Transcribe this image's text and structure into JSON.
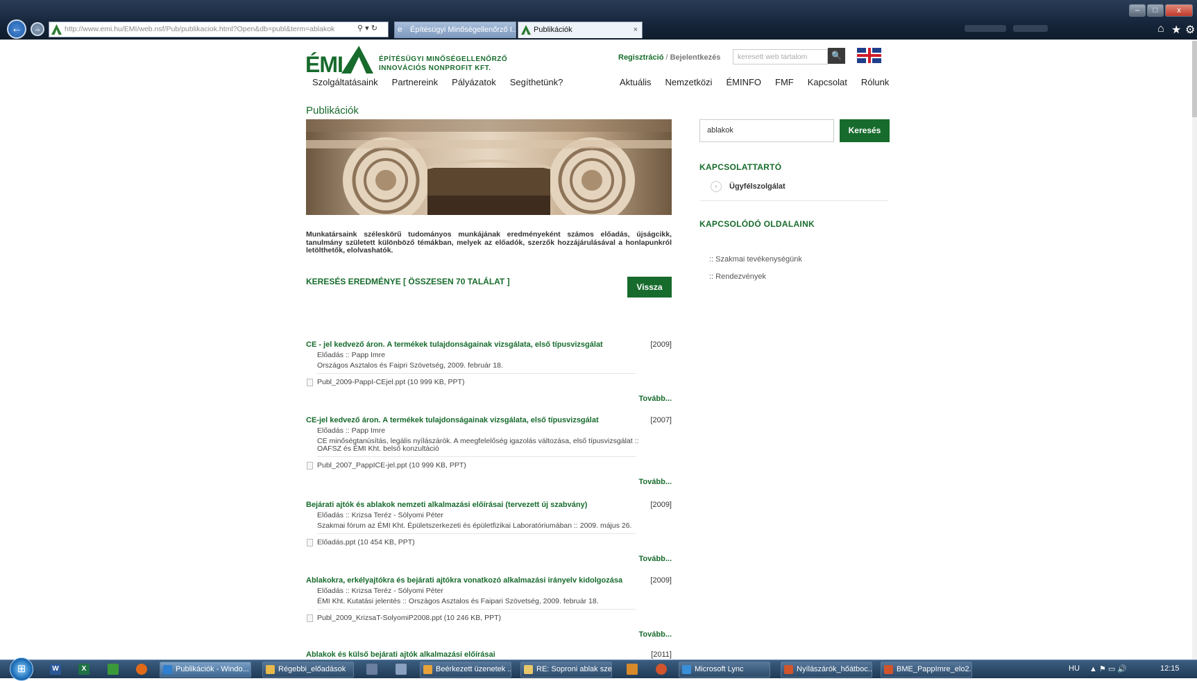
{
  "browser": {
    "address": "http://www.emi.hu/EMI/web.nsf/Pub/publikaciok.html?Open&db=publ&term=ablakok",
    "tabs": [
      {
        "label": "Építésügyi Minőségellenőrző I..."
      },
      {
        "label": "Publikációk",
        "close": "×"
      }
    ],
    "window_controls": [
      "–",
      "□",
      "x"
    ],
    "toolbar_icons": [
      "home-icon",
      "star-icon",
      "gear-icon"
    ]
  },
  "header": {
    "logo_mark": "ÉMI",
    "logo_line1": "ÉPÍTÉSÜGYI MINŐSÉGELLENŐRZŐ",
    "logo_line2": "INNOVÁCIÓS NONPROFIT KFT.",
    "register": "Regisztráció",
    "separator": "/",
    "login": "Bejelentkezés",
    "search_placeholder": "keresett web tartalom",
    "search_icon": "🔍"
  },
  "nav_left": [
    "Szolgáltatásaink",
    "Partnereink",
    "Pályázatok",
    "Segíthetünk?"
  ],
  "nav_right": [
    "Aktuális",
    "Nemzetközi",
    "ÉMINFO",
    "FMF",
    "Kapcsolat",
    "Rólunk"
  ],
  "page": {
    "title": "Publikációk",
    "intro": "Munkatársaink széleskörű tudományos munkájának eredményeként számos előadás, újságcikk, tanulmány született különböző témákban, melyek az előadók, szerzők hozzájárulásával a honlapunkról letölthetők, elolvashatók.",
    "results_heading": "KERESÉS EREDMÉNYE [ ÖSSZESEN 70 TALÁLAT ]",
    "back_button": "Vissza"
  },
  "results": [
    {
      "title": "CE - jel kedvező áron. A termékek tulajdonságainak vizsgálata, első típusvizsgálat",
      "year": "[2009]",
      "line1": "Előadás :: Papp Imre",
      "line2": "Országos Asztalos és Faipri Szövetség, 2009. február 18.",
      "file": "Publ_2009-PappI-CEjel.ppt (10 999 KB, PPT)",
      "more": "Tovább..."
    },
    {
      "title": "CE-jel kedvező áron. A termékek tulajdonságainak vizsgálata, első típusvizsgálat",
      "year": "[2007]",
      "line1": "Előadás :: Papp Imre",
      "line2": "CE minőségtanúsítás, legális nyílászárók. A meegfelelőség igazolás változása, első típusvizsgálat :: OAFSZ és ÉMI Kht. belső konzultáció",
      "file": "Publ_2007_PappICE-jel.ppt (10 999 KB, PPT)",
      "more": "Tovább..."
    },
    {
      "title": "Bejárati ajtók és ablakok nemzeti alkalmazási előírásai (tervezett új szabvány)",
      "year": "[2009]",
      "line1": "Előadás :: Krizsa Teréz - Sólyomi Péter",
      "line2": "Szakmai fórum az ÉMI Kht. Épületszerkezeti és épületfizikai Laboratóriumában :: 2009. május 26.",
      "file": "Előadás.ppt (10 454 KB, PPT)",
      "more": "Tovább..."
    },
    {
      "title": "Ablakokra, erkélyajtókra és bejárati ajtókra vonatkozó alkalmazási irányelv kidolgozása",
      "year": "[2009]",
      "line1": "Előadás :: Krizsa Teréz - Sólyomi Péter",
      "line2": "ÉMI Kht. Kutatási jelentés :: Országos Asztalos és Faipari Szövetség, 2009. február 18.",
      "file": "Publ_2009_KrizsaT-SolyomiP2008.ppt (10 246 KB, PPT)",
      "more": "Tovább..."
    },
    {
      "title": "Ablakok és külső bejárati ajtók alkalmazási előírásai",
      "year": "[2011]"
    }
  ],
  "sidebar": {
    "search_value": "ablakok",
    "search_button": "Keresés",
    "contact_heading": "KAPCSOLATTARTÓ",
    "contact_item": "Ügyfélszolgálat",
    "related_heading": "KAPCSOLÓDÓ OLDALAINK",
    "related": [
      ":: Szakmai tevékenységünk",
      ":: Rendezvények"
    ]
  },
  "taskbar": {
    "items": [
      {
        "label": "Publikációk - Windo...",
        "color": "#2f7fd0"
      },
      {
        "label": "Régebbi_előadások",
        "color": "#e8b84a"
      },
      {
        "label": "Beérkezett üzenetek ...",
        "color": "#e8a23a"
      },
      {
        "label": "RE: Soproni ablak sze...",
        "color": "#e8c86a"
      },
      {
        "label": "Microsoft Lync",
        "color": "#3a8fd8"
      },
      {
        "label": "Nyílászárók_hőátboc...",
        "color": "#d2542c"
      },
      {
        "label": "BME_PappImre_elo2...",
        "color": "#d2542c"
      }
    ],
    "lang": "HU",
    "clock": "12:15"
  }
}
